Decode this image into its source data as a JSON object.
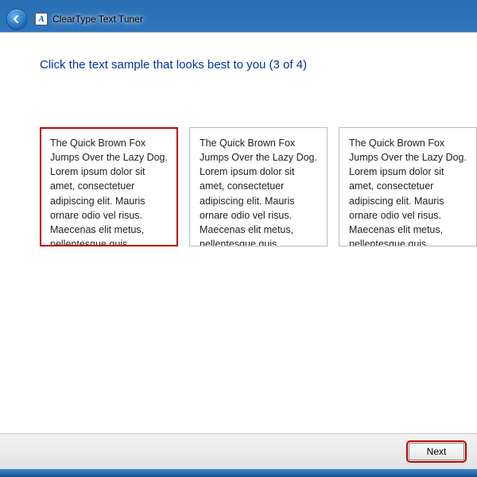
{
  "titlebar": {
    "app_icon_letter": "A",
    "title": "ClearType Text Tuner"
  },
  "heading": "Click the text sample that looks best to you (3 of 4)",
  "sample_text": "The Quick Brown Fox Jumps Over the Lazy Dog. Lorem ipsum dolor sit amet, consectetuer adipiscing elit. Mauris ornare odio vel risus. Maecenas elit metus, pellentesque quis, pretium.",
  "samples": [
    {
      "selected": true
    },
    {
      "selected": false
    },
    {
      "selected": false
    }
  ],
  "footer": {
    "next_label": "Next"
  }
}
